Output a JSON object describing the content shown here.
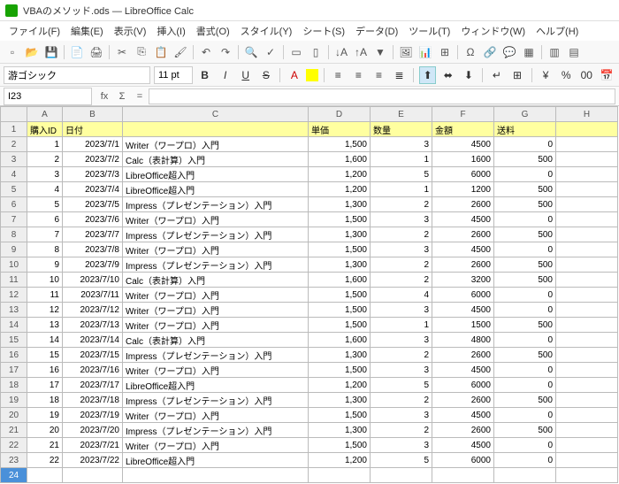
{
  "title": "VBAのメソッド.ods — LibreOffice Calc",
  "menu": [
    "ファイル(F)",
    "編集(E)",
    "表示(V)",
    "挿入(I)",
    "書式(O)",
    "スタイル(Y)",
    "シート(S)",
    "データ(D)",
    "ツール(T)",
    "ウィンドウ(W)",
    "ヘルプ(H)"
  ],
  "font_name": "游ゴシック",
  "font_size": "11 pt",
  "cell_ref": "I23",
  "columns": [
    "A",
    "B",
    "C",
    "D",
    "E",
    "F",
    "G",
    "H"
  ],
  "headers": {
    "A": "購入ID",
    "B": "日付",
    "C": "",
    "D": "単価",
    "E": "数量",
    "F": "金額",
    "G": "送料",
    "H": ""
  },
  "rows": [
    {
      "n": 1,
      "d": "2023/7/1",
      "t": "Writer（ワープロ）入門",
      "p": "1,500",
      "q": "3",
      "a": "4500",
      "s": "0"
    },
    {
      "n": 2,
      "d": "2023/7/2",
      "t": "Calc（表計算）入門",
      "p": "1,600",
      "q": "1",
      "a": "1600",
      "s": "500"
    },
    {
      "n": 3,
      "d": "2023/7/3",
      "t": "LibreOffice超入門",
      "p": "1,200",
      "q": "5",
      "a": "6000",
      "s": "0"
    },
    {
      "n": 4,
      "d": "2023/7/4",
      "t": "LibreOffice超入門",
      "p": "1,200",
      "q": "1",
      "a": "1200",
      "s": "500"
    },
    {
      "n": 5,
      "d": "2023/7/5",
      "t": "Impress（プレゼンテーション）入門",
      "p": "1,300",
      "q": "2",
      "a": "2600",
      "s": "500"
    },
    {
      "n": 6,
      "d": "2023/7/6",
      "t": "Writer（ワープロ）入門",
      "p": "1,500",
      "q": "3",
      "a": "4500",
      "s": "0"
    },
    {
      "n": 7,
      "d": "2023/7/7",
      "t": "Impress（プレゼンテーション）入門",
      "p": "1,300",
      "q": "2",
      "a": "2600",
      "s": "500"
    },
    {
      "n": 8,
      "d": "2023/7/8",
      "t": "Writer（ワープロ）入門",
      "p": "1,500",
      "q": "3",
      "a": "4500",
      "s": "0"
    },
    {
      "n": 9,
      "d": "2023/7/9",
      "t": "Impress（プレゼンテーション）入門",
      "p": "1,300",
      "q": "2",
      "a": "2600",
      "s": "500"
    },
    {
      "n": 10,
      "d": "2023/7/10",
      "t": "Calc（表計算）入門",
      "p": "1,600",
      "q": "2",
      "a": "3200",
      "s": "500"
    },
    {
      "n": 11,
      "d": "2023/7/11",
      "t": "Writer（ワープロ）入門",
      "p": "1,500",
      "q": "4",
      "a": "6000",
      "s": "0"
    },
    {
      "n": 12,
      "d": "2023/7/12",
      "t": "Writer（ワープロ）入門",
      "p": "1,500",
      "q": "3",
      "a": "4500",
      "s": "0"
    },
    {
      "n": 13,
      "d": "2023/7/13",
      "t": "Writer（ワープロ）入門",
      "p": "1,500",
      "q": "1",
      "a": "1500",
      "s": "500"
    },
    {
      "n": 14,
      "d": "2023/7/14",
      "t": "Calc（表計算）入門",
      "p": "1,600",
      "q": "3",
      "a": "4800",
      "s": "0"
    },
    {
      "n": 15,
      "d": "2023/7/15",
      "t": "Impress（プレゼンテーション）入門",
      "p": "1,300",
      "q": "2",
      "a": "2600",
      "s": "500"
    },
    {
      "n": 16,
      "d": "2023/7/16",
      "t": "Writer（ワープロ）入門",
      "p": "1,500",
      "q": "3",
      "a": "4500",
      "s": "0"
    },
    {
      "n": 17,
      "d": "2023/7/17",
      "t": "LibreOffice超入門",
      "p": "1,200",
      "q": "5",
      "a": "6000",
      "s": "0"
    },
    {
      "n": 18,
      "d": "2023/7/18",
      "t": "Impress（プレゼンテーション）入門",
      "p": "1,300",
      "q": "2",
      "a": "2600",
      "s": "500"
    },
    {
      "n": 19,
      "d": "2023/7/19",
      "t": "Writer（ワープロ）入門",
      "p": "1,500",
      "q": "3",
      "a": "4500",
      "s": "0"
    },
    {
      "n": 20,
      "d": "2023/7/20",
      "t": "Impress（プレゼンテーション）入門",
      "p": "1,300",
      "q": "2",
      "a": "2600",
      "s": "500"
    },
    {
      "n": 21,
      "d": "2023/7/21",
      "t": "Writer（ワープロ）入門",
      "p": "1,500",
      "q": "3",
      "a": "4500",
      "s": "0"
    },
    {
      "n": 22,
      "d": "2023/7/22",
      "t": "LibreOffice超入門",
      "p": "1,200",
      "q": "5",
      "a": "6000",
      "s": "0"
    }
  ],
  "selected_row": 23
}
